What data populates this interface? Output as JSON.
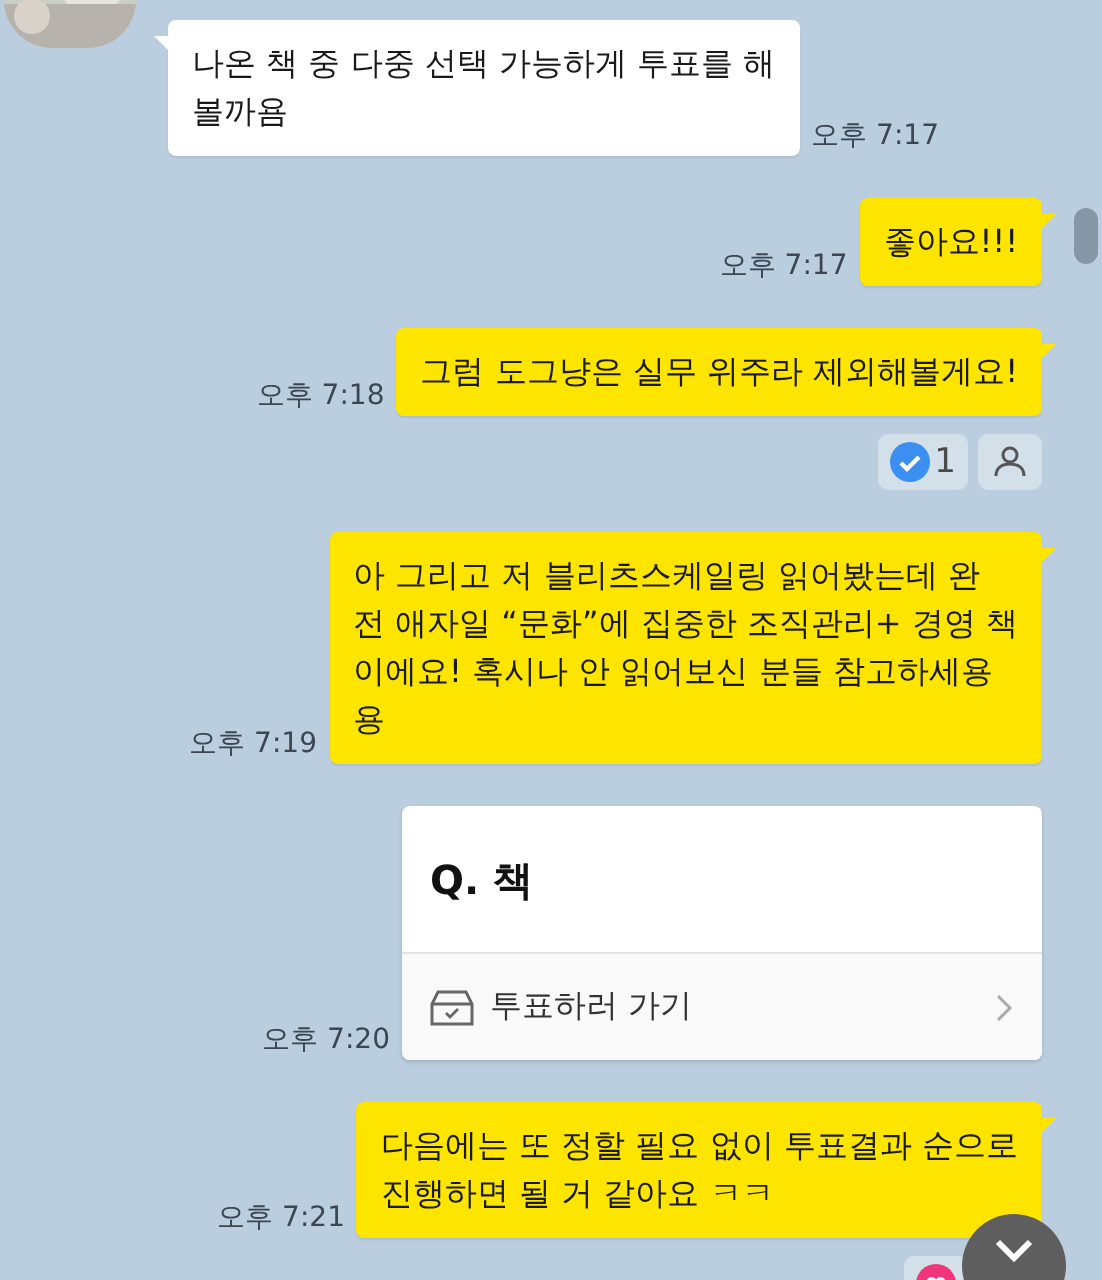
{
  "messages": [
    {
      "kind": "incoming",
      "lines": [
        "나온 책 중 다중 선택 가능하게 투표를 해",
        "볼까욤"
      ],
      "time": "오후 7:17"
    },
    {
      "kind": "outgoing",
      "lines": [
        "좋아요!!!"
      ],
      "time": "오후 7:17"
    },
    {
      "kind": "outgoing",
      "lines": [
        "그럼 도그냥은 실무 위주라 제외해볼게요!"
      ],
      "time": "오후 7:18",
      "reaction": {
        "kind": "check",
        "count": "1"
      },
      "readers_button": true
    },
    {
      "kind": "outgoing",
      "lines": [
        "아 그리고 저 블리츠스케일링 읽어봤는데 완",
        "전 애자일 “문화”에 집중한 조직관리+ 경영 책",
        "이에요! 혹시나 안 읽어보신 분들 참고하세용",
        "용"
      ],
      "time": "오후 7:19"
    },
    {
      "kind": "poll",
      "question": "Q. 책",
      "action": "투표하러 가기",
      "time": "오후 7:20"
    },
    {
      "kind": "outgoing",
      "lines": [
        "다음에는 또 정할 필요 없이 투표결과 순으로",
        "진행하면 될 거 같아요 ㅋㅋ"
      ],
      "time": "오후 7:21",
      "reaction": {
        "kind": "heart"
      }
    }
  ]
}
